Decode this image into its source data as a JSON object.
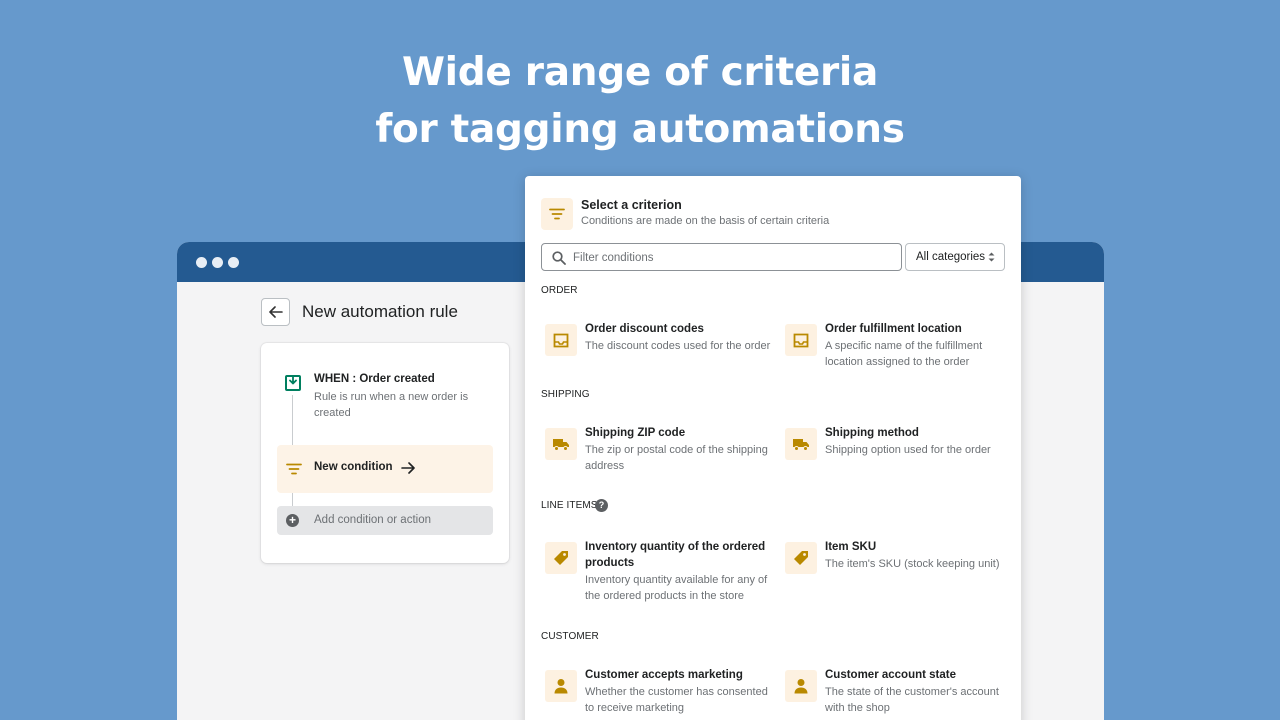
{
  "headline": {
    "line1": "Wide range of criteria",
    "line2": "for tagging automations"
  },
  "colors": {
    "background": "#6699cc",
    "browser_bar": "#245a91",
    "accent_icon": "#b98900",
    "icon_bg": "#fdf1e1",
    "when_icon": "#007f5f"
  },
  "app": {
    "back_icon": "arrow-left-icon",
    "page_title": "New automation rule",
    "rule": {
      "trigger_title": "WHEN : Order created",
      "trigger_desc": "Rule is run when a new order is created",
      "new_condition_label": "New condition",
      "add_label": "Add condition or action"
    }
  },
  "panel": {
    "title": "Select a criterion",
    "subtitle": "Conditions are made on the basis of certain criteria",
    "filter_placeholder": "Filter conditions",
    "category_select": "All categories",
    "sections": [
      {
        "label": "ORDER",
        "items": [
          {
            "icon": "inbox-icon",
            "title": "Order discount codes",
            "desc": "The discount codes used for the order"
          },
          {
            "icon": "inbox-icon",
            "title": "Order fulfillment location",
            "desc": "A specific name of the fulfillment location assigned to the order"
          }
        ]
      },
      {
        "label": "SHIPPING",
        "items": [
          {
            "icon": "truck-icon",
            "title": "Shipping ZIP code",
            "desc": "The zip or postal code of the shipping address"
          },
          {
            "icon": "truck-icon",
            "title": "Shipping method",
            "desc": "Shipping option used for the order"
          }
        ]
      },
      {
        "label": "LINE ITEMS",
        "items": [
          {
            "icon": "tag-icon",
            "title": "Inventory quantity of the ordered products",
            "desc": "Inventory quantity available for any of the ordered products in the store"
          },
          {
            "icon": "tag-icon",
            "title": "Item SKU",
            "desc": "The item's SKU (stock keeping unit)"
          }
        ]
      },
      {
        "label": "CUSTOMER",
        "items": [
          {
            "icon": "person-icon",
            "title": "Customer accepts marketing",
            "desc": "Whether the customer has consented to receive marketing"
          },
          {
            "icon": "person-icon",
            "title": "Customer account state",
            "desc": "The state of the customer's account with the shop"
          }
        ]
      }
    ]
  }
}
